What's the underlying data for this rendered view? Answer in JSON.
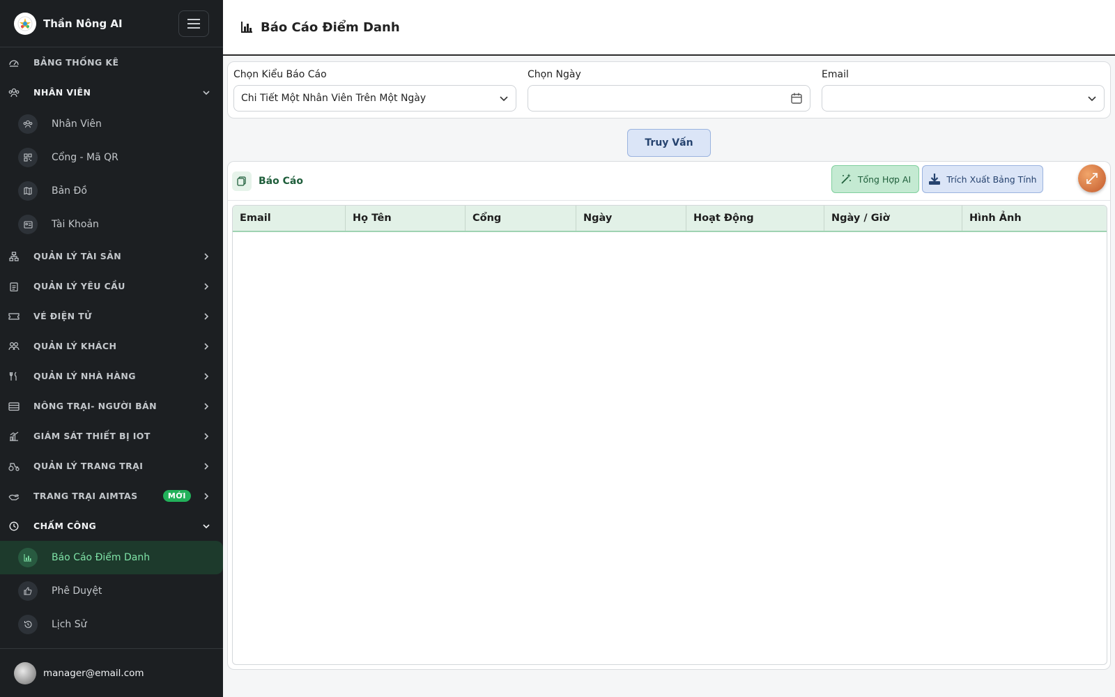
{
  "brand": {
    "name": "Thần Nông AI"
  },
  "sidebar": {
    "sections": [
      {
        "label": "BẢNG THỐNG KÊ",
        "icon": "dashboard-icon",
        "expandable": false
      },
      {
        "label": "NHÂN VIÊN",
        "icon": "team-icon",
        "expandable": true,
        "open": true,
        "children": [
          {
            "label": "Nhân Viên",
            "icon": "people-icon"
          },
          {
            "label": "Cổng - Mã QR",
            "icon": "qr-icon"
          },
          {
            "label": "Bản Đồ",
            "icon": "map-icon"
          },
          {
            "label": "Tài Khoản",
            "icon": "id-card-icon"
          }
        ]
      },
      {
        "label": "QUẢN LÝ TÀI SẢN",
        "icon": "asset-icon",
        "expandable": true
      },
      {
        "label": "QUẢN LÝ YÊU CẦU",
        "icon": "clipboard-icon",
        "expandable": true
      },
      {
        "label": "VÉ ĐIỆN TỬ",
        "icon": "ticket-icon",
        "expandable": true
      },
      {
        "label": "QUẢN LÝ KHÁCH",
        "icon": "guests-icon",
        "expandable": true
      },
      {
        "label": "QUẢN LÝ NHÀ HÀNG",
        "icon": "restaurant-icon",
        "expandable": true
      },
      {
        "label": "NÔNG TRẠI- NGƯỜI BÁN",
        "icon": "store-icon",
        "expandable": true
      },
      {
        "label": "GIÁM SÁT THIẾT BỊ IOT",
        "icon": "chart-icon",
        "expandable": true
      },
      {
        "label": "QUẢN LÝ TRANG TRẠI",
        "icon": "tractor-icon",
        "expandable": true
      },
      {
        "label": "TRANG TRẠI AIMTAS",
        "icon": "hand-icon",
        "expandable": true,
        "badge": "MỚI"
      },
      {
        "label": "CHẤM CÔNG",
        "icon": "clock-icon",
        "expandable": true,
        "open": true,
        "children": [
          {
            "label": "Báo Cáo Điểm Danh",
            "icon": "bar-chart-icon",
            "active": true
          },
          {
            "label": "Phê Duyệt",
            "icon": "thumbs-up-icon"
          },
          {
            "label": "Lịch Sử",
            "icon": "history-icon"
          }
        ]
      }
    ]
  },
  "user": {
    "email": "manager@email.com"
  },
  "header": {
    "title": "Báo Cáo Điểm Danh"
  },
  "filters": {
    "report_type": {
      "label": "Chọn Kiểu Báo Cáo",
      "value": "Chi Tiết Một Nhân Viên Trên Một Ngày"
    },
    "date": {
      "label": "Chọn Ngày",
      "value": ""
    },
    "email": {
      "label": "Email",
      "value": ""
    }
  },
  "query_button": "Truy Vấn",
  "report": {
    "title": "Báo Cáo",
    "ai_button": "Tổng Hợp AI",
    "export_button": "Trích Xuất Bảng Tính",
    "columns": [
      "Email",
      "Họ Tên",
      "Cổng",
      "Ngày",
      "Hoạt Động",
      "Ngày / Giờ",
      "Hình Ảnh"
    ]
  },
  "colors": {
    "sidebar_bg": "#1c1f22",
    "active_bg": "#1d3a2c",
    "active_text": "#7fe3a7",
    "badge_green": "#22b15a",
    "table_header_bg": "#e2f1e7"
  }
}
